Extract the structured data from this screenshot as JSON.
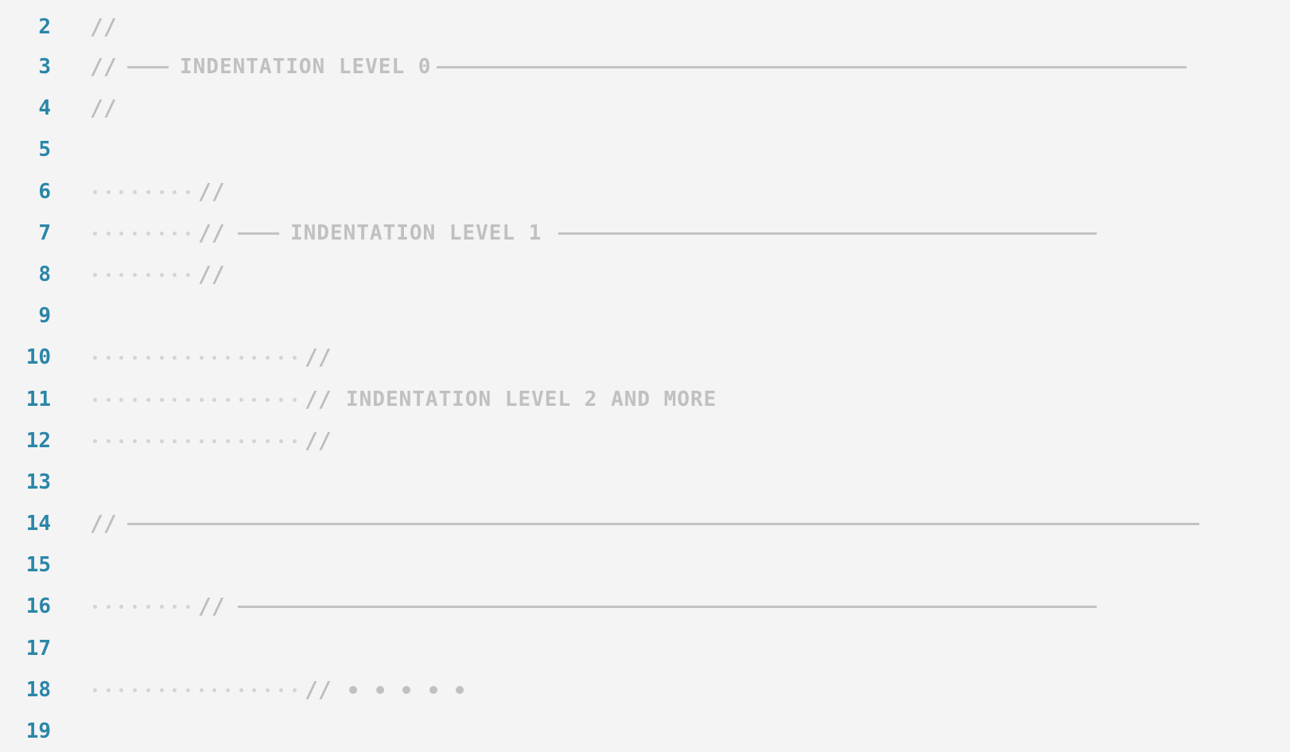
{
  "lines": [
    {
      "num": "2",
      "indent": 0,
      "slash": "//"
    },
    {
      "num": "3",
      "indent": 0,
      "slash": "//",
      "label": "INDENTATION LEVEL 0"
    },
    {
      "num": "4",
      "indent": 0,
      "slash": "//"
    },
    {
      "num": "5"
    },
    {
      "num": "6",
      "indent": 1,
      "slash": "//"
    },
    {
      "num": "7",
      "indent": 1,
      "slash": "//",
      "label": "INDENTATION LEVEL 1"
    },
    {
      "num": "8",
      "indent": 1,
      "slash": "//"
    },
    {
      "num": "9"
    },
    {
      "num": "10",
      "indent": 2,
      "slash": "//"
    },
    {
      "num": "11",
      "indent": 2,
      "slash": "//",
      "label": "INDENTATION LEVEL 2 AND MORE"
    },
    {
      "num": "12",
      "indent": 2,
      "slash": "//"
    },
    {
      "num": "13"
    },
    {
      "num": "14",
      "indent": 0,
      "slash": "//"
    },
    {
      "num": "15"
    },
    {
      "num": "16",
      "indent": 1,
      "slash": "//"
    },
    {
      "num": "17"
    },
    {
      "num": "18",
      "indent": 2,
      "slash": "//"
    },
    {
      "num": "19"
    }
  ],
  "colors": {
    "background": "#f4f4f4",
    "line_number": "#2a86a8",
    "comment": "#bdbdbd",
    "whitespace_dot": "#d4d4d4",
    "rule": "#c3c3c3"
  }
}
